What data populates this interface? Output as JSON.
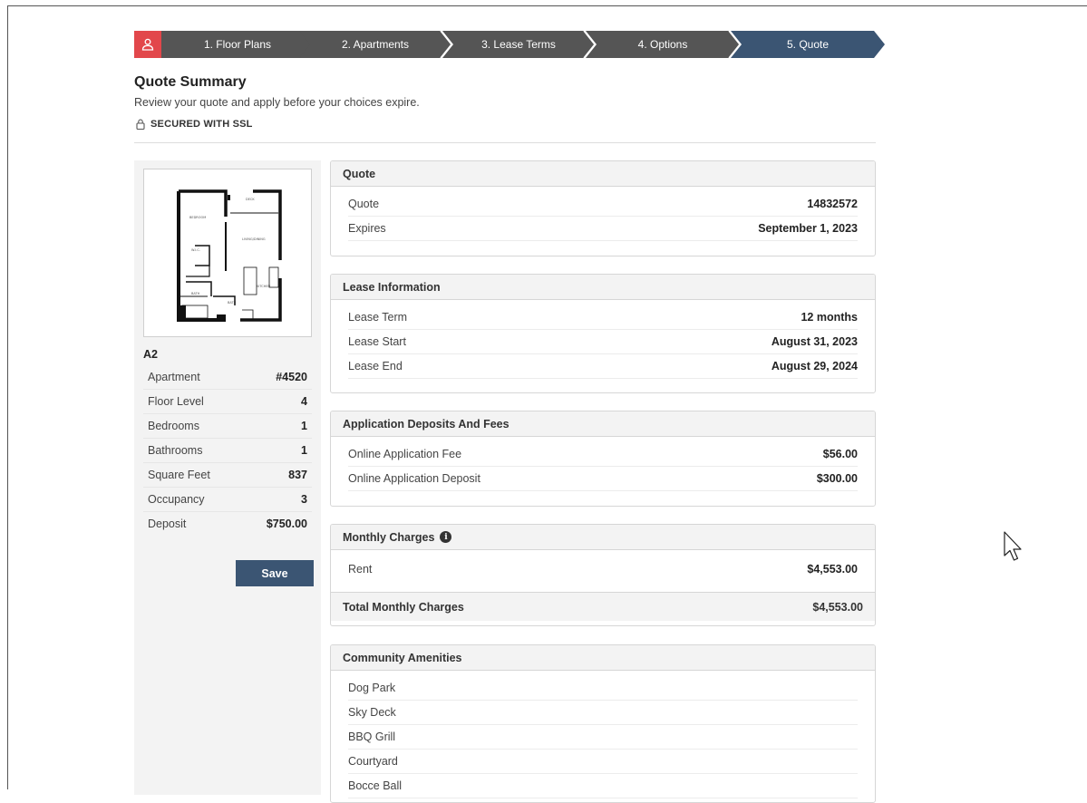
{
  "stepper": {
    "steps": [
      {
        "label": "1. Floor Plans",
        "active": false
      },
      {
        "label": "2. Apartments",
        "active": false
      },
      {
        "label": "3. Lease Terms",
        "active": false
      },
      {
        "label": "4. Options",
        "active": false
      },
      {
        "label": "5. Quote",
        "active": true
      }
    ],
    "colors": {
      "inactive": "#555555",
      "active": "#3b5573",
      "user": "#e2474b"
    }
  },
  "header": {
    "title": "Quote Summary",
    "subtitle": "Review your quote and apply before your choices expire.",
    "ssl": "SECURED WITH SSL"
  },
  "unit": {
    "plan_name": "A2",
    "specs": [
      {
        "label": "Apartment",
        "value": "#4520"
      },
      {
        "label": "Floor Level",
        "value": "4"
      },
      {
        "label": "Bedrooms",
        "value": "1"
      },
      {
        "label": "Bathrooms",
        "value": "1"
      },
      {
        "label": "Square Feet",
        "value": "837"
      },
      {
        "label": "Occupancy",
        "value": "3"
      },
      {
        "label": "Deposit",
        "value": "$750.00"
      }
    ],
    "save_label": "Save"
  },
  "quote": {
    "heading": "Quote",
    "rows": [
      {
        "label": "Quote",
        "value": "14832572"
      },
      {
        "label": "Expires",
        "value": "September 1, 2023"
      }
    ]
  },
  "lease": {
    "heading": "Lease Information",
    "rows": [
      {
        "label": "Lease Term",
        "value": "12 months"
      },
      {
        "label": "Lease Start",
        "value": "August 31, 2023"
      },
      {
        "label": "Lease End",
        "value": "August 29, 2024"
      }
    ]
  },
  "fees": {
    "heading": "Application Deposits And Fees",
    "rows": [
      {
        "label": "Online Application Fee",
        "value": "$56.00"
      },
      {
        "label": "Online Application Deposit",
        "value": "$300.00"
      }
    ]
  },
  "monthly": {
    "heading": "Monthly Charges",
    "info_icon": "i",
    "rows": [
      {
        "label": "Rent",
        "value": "$4,553.00"
      }
    ],
    "total_label": "Total Monthly Charges",
    "total_value": "$4,553.00"
  },
  "amenities": {
    "heading": "Community Amenities",
    "items": [
      "Dog Park",
      "Sky Deck",
      "BBQ Grill",
      "Courtyard",
      "Bocce Ball"
    ]
  }
}
